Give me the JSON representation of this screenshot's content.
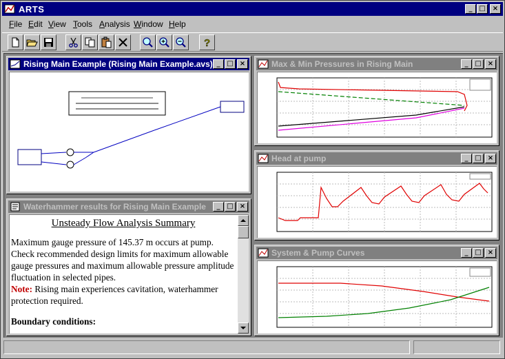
{
  "app": {
    "title": "ARTS",
    "menu": [
      {
        "label": "File",
        "u": "F",
        "rest": "ile"
      },
      {
        "label": "Edit",
        "u": "E",
        "rest": "dit"
      },
      {
        "label": "View",
        "u": "V",
        "rest": "iew"
      },
      {
        "label": "Tools",
        "u": "T",
        "rest": "ools"
      },
      {
        "label": "Analysis",
        "u": "A",
        "rest": "nalysis"
      },
      {
        "label": "Window",
        "u": "W",
        "rest": "indow"
      },
      {
        "label": "Help",
        "u": "H",
        "rest": "elp"
      }
    ],
    "toolbar": [
      "new-file-icon",
      "open-folder-icon",
      "save-icon",
      "cut-icon",
      "copy-icon",
      "paste-icon",
      "delete-icon",
      "zoom-icon",
      "zoom-in-icon",
      "zoom-out-icon",
      "help-icon"
    ],
    "caption": {
      "minimize": "_",
      "maximize": "□",
      "close": "×"
    }
  },
  "windows": {
    "schematic": {
      "title": "Rising Main Example (Rising Main Example.avs)"
    },
    "results": {
      "title": "Waterhammer results for Rising Main Example",
      "heading": "Unsteady Flow Analysis Summary",
      "paragraph": "Maximum gauge pressure of 145.37 m occurs at pump. Check recommended design limits for maximum allowable gauge pressures and maximum allowable pressure amplitude fluctuation in selected pipes.",
      "note_label": "Note:",
      "note_text": " Rising main experiences cavitation, waterhammer protection required.",
      "boundary_heading": "Boundary conditions:"
    },
    "pressures": {
      "title": "Max & Min Pressures in Rising Main"
    },
    "head": {
      "title": "Head at pump"
    },
    "curves": {
      "title": "System & Pump Curves"
    }
  },
  "colors": {
    "active_title": "#000080",
    "inactive_title": "#808080",
    "plot_red": "#e00000",
    "plot_green": "#008000",
    "plot_magenta": "#e000e0",
    "plot_black": "#000000"
  }
}
